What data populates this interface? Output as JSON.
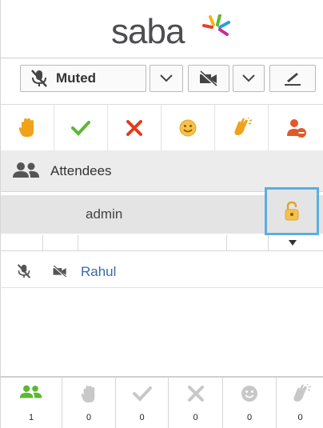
{
  "app": {
    "brand": "saba"
  },
  "av_controls": {
    "mic": {
      "label": "Muted",
      "icon": "mic-off-icon"
    },
    "mic_dropdown_icon": "chevron-down-icon",
    "camera_icon": "camera-off-icon",
    "camera_dropdown_icon": "chevron-down-icon",
    "pen_icon": "pen-icon"
  },
  "feedback_buttons": [
    {
      "name": "raise-hand",
      "icon": "raise-hand-icon",
      "color": "#f0a21a"
    },
    {
      "name": "agree",
      "icon": "checkmark-icon",
      "color": "#5cb833"
    },
    {
      "name": "disagree",
      "icon": "x-icon",
      "color": "#e23b1b"
    },
    {
      "name": "smile",
      "icon": "smiley-icon",
      "color": "#f5c14a"
    },
    {
      "name": "applause",
      "icon": "clapping-hands-icon",
      "color": "#f0a21a"
    },
    {
      "name": "away",
      "icon": "user-away-icon",
      "color": "#e0592a"
    }
  ],
  "attendees_panel": {
    "title": "Attendees",
    "host": {
      "name": "admin",
      "lock_icon": "lock-icon"
    },
    "list": [
      {
        "name": "Rahul",
        "mic_icon": "mic-off-icon",
        "camera_icon": "camera-off-icon"
      }
    ]
  },
  "footer_counts": [
    {
      "icon": "attendees-icon",
      "count": "1",
      "color": "#5cb833"
    },
    {
      "icon": "raise-hand-icon",
      "count": "0",
      "color": "#c8c8c8"
    },
    {
      "icon": "checkmark-icon",
      "count": "0",
      "color": "#c8c8c8"
    },
    {
      "icon": "x-icon",
      "count": "0",
      "color": "#c8c8c8"
    },
    {
      "icon": "smiley-icon",
      "count": "0",
      "color": "#c8c8c8"
    },
    {
      "icon": "clapping-hands-icon",
      "count": "0",
      "color": "#c8c8c8"
    }
  ]
}
